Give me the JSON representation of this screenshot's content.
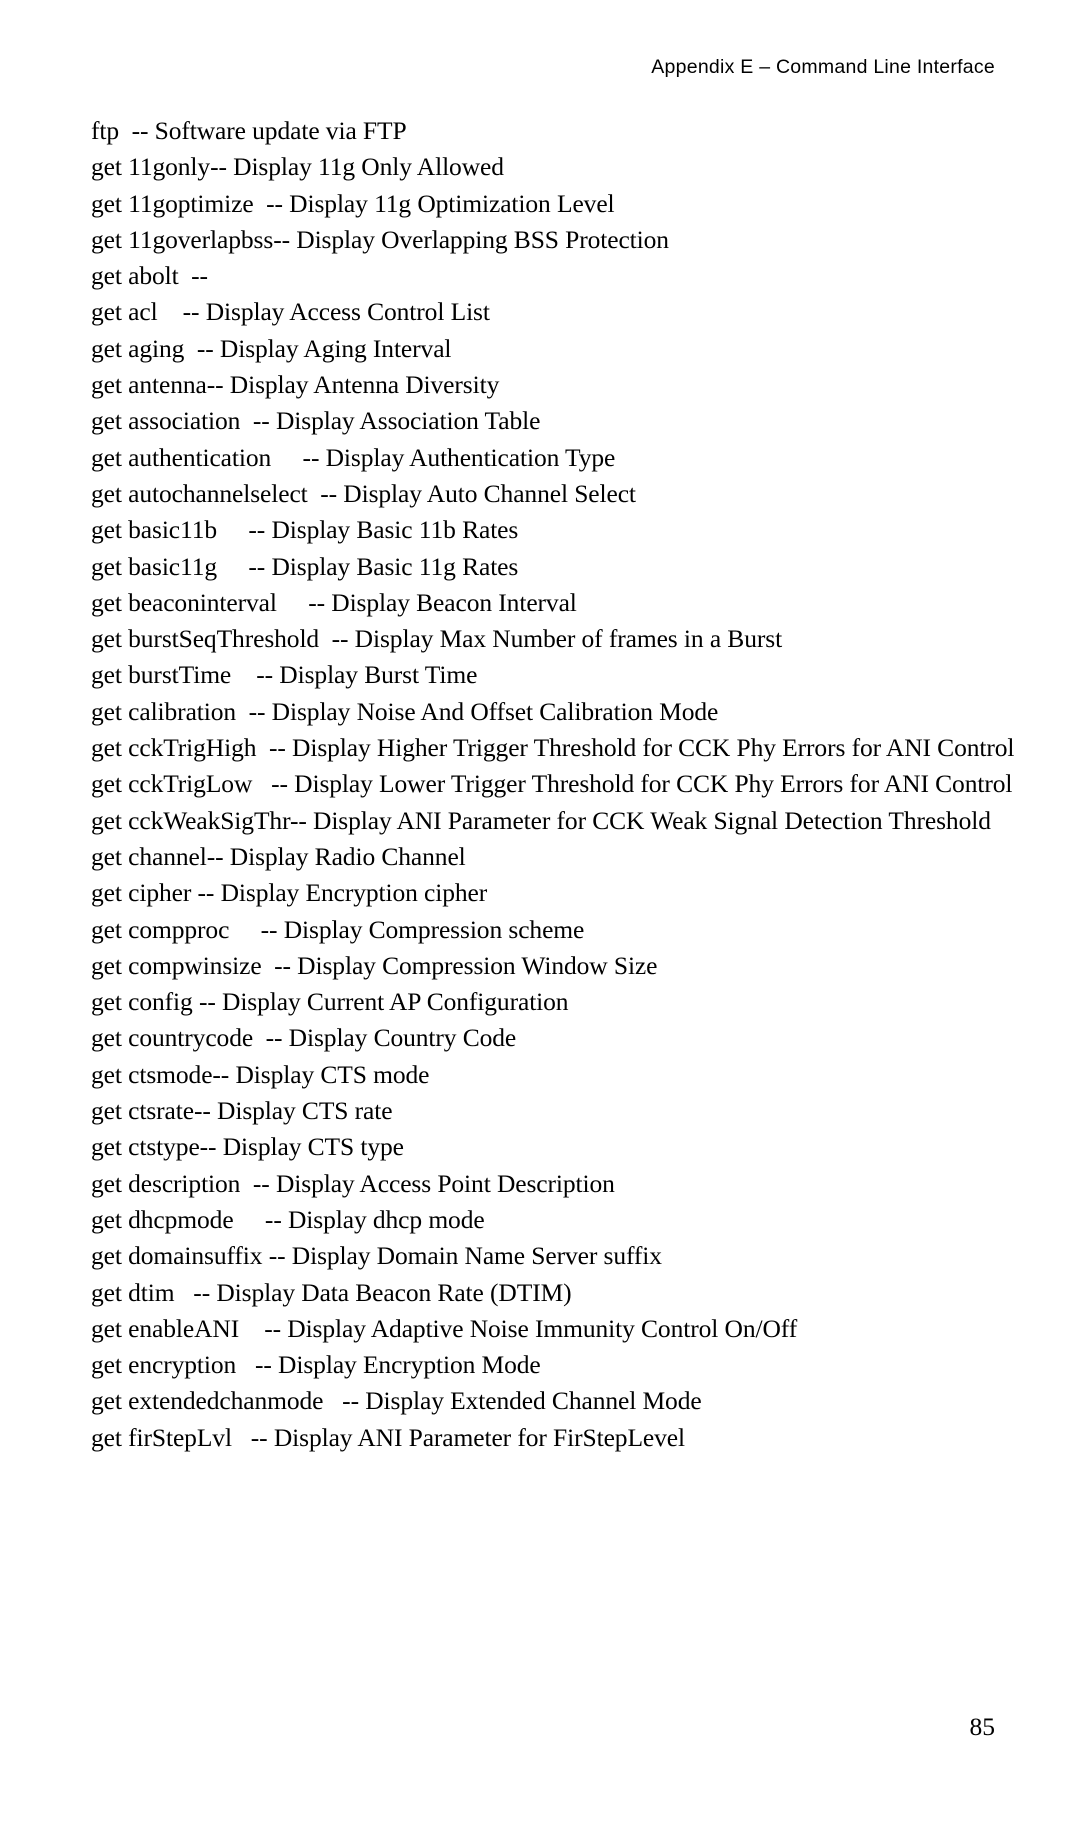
{
  "header": {
    "running_head": "Appendix E – Command Line Interface"
  },
  "footer": {
    "page_number": "85"
  },
  "document": {
    "lines": [
      "ftp  -- Software update via FTP",
      "get 11gonly-- Display 11g Only Allowed",
      "get 11goptimize  -- Display 11g Optimization Level",
      "get 11goverlapbss-- Display Overlapping BSS Protection",
      "get abolt  --",
      "get acl    -- Display Access Control List",
      "get aging  -- Display Aging Interval",
      "get antenna-- Display Antenna Diversity",
      "get association  -- Display Association Table",
      "get authentication     -- Display Authentication Type",
      "get autochannelselect  -- Display Auto Channel Select",
      "get basic11b     -- Display Basic 11b Rates",
      "get basic11g     -- Display Basic 11g Rates",
      "get beaconinterval     -- Display Beacon Interval",
      "get burstSeqThreshold  -- Display Max Number of frames in a Burst",
      "get burstTime    -- Display Burst Time",
      "get calibration  -- Display Noise And Offset Calibration Mode",
      "get cckTrigHigh  -- Display Higher Trigger Threshold for CCK Phy Errors for ANI Control",
      "get cckTrigLow   -- Display Lower Trigger Threshold for CCK Phy Errors for ANI Control",
      "get cckWeakSigThr-- Display ANI Parameter for CCK Weak Signal Detection Threshold",
      "get channel-- Display Radio Channel",
      "get cipher -- Display Encryption cipher",
      "get compproc     -- Display Compression scheme",
      "get compwinsize  -- Display Compression Window Size",
      "get config -- Display Current AP Configuration",
      "get countrycode  -- Display Country Code",
      "get ctsmode-- Display CTS mode",
      "get ctsrate-- Display CTS rate",
      "get ctstype-- Display CTS type",
      "get description  -- Display Access Point Description",
      "get dhcpmode     -- Display dhcp mode",
      "get domainsuffix -- Display Domain Name Server suffix",
      "get dtim   -- Display Data Beacon Rate (DTIM)",
      "get enableANI    -- Display Adaptive Noise Immunity Control On/Off",
      "get encryption   -- Display Encryption Mode",
      "get extendedchanmode   -- Display Extended Channel Mode",
      "get firStepLvl   -- Display ANI Parameter for FirStepLevel"
    ]
  }
}
